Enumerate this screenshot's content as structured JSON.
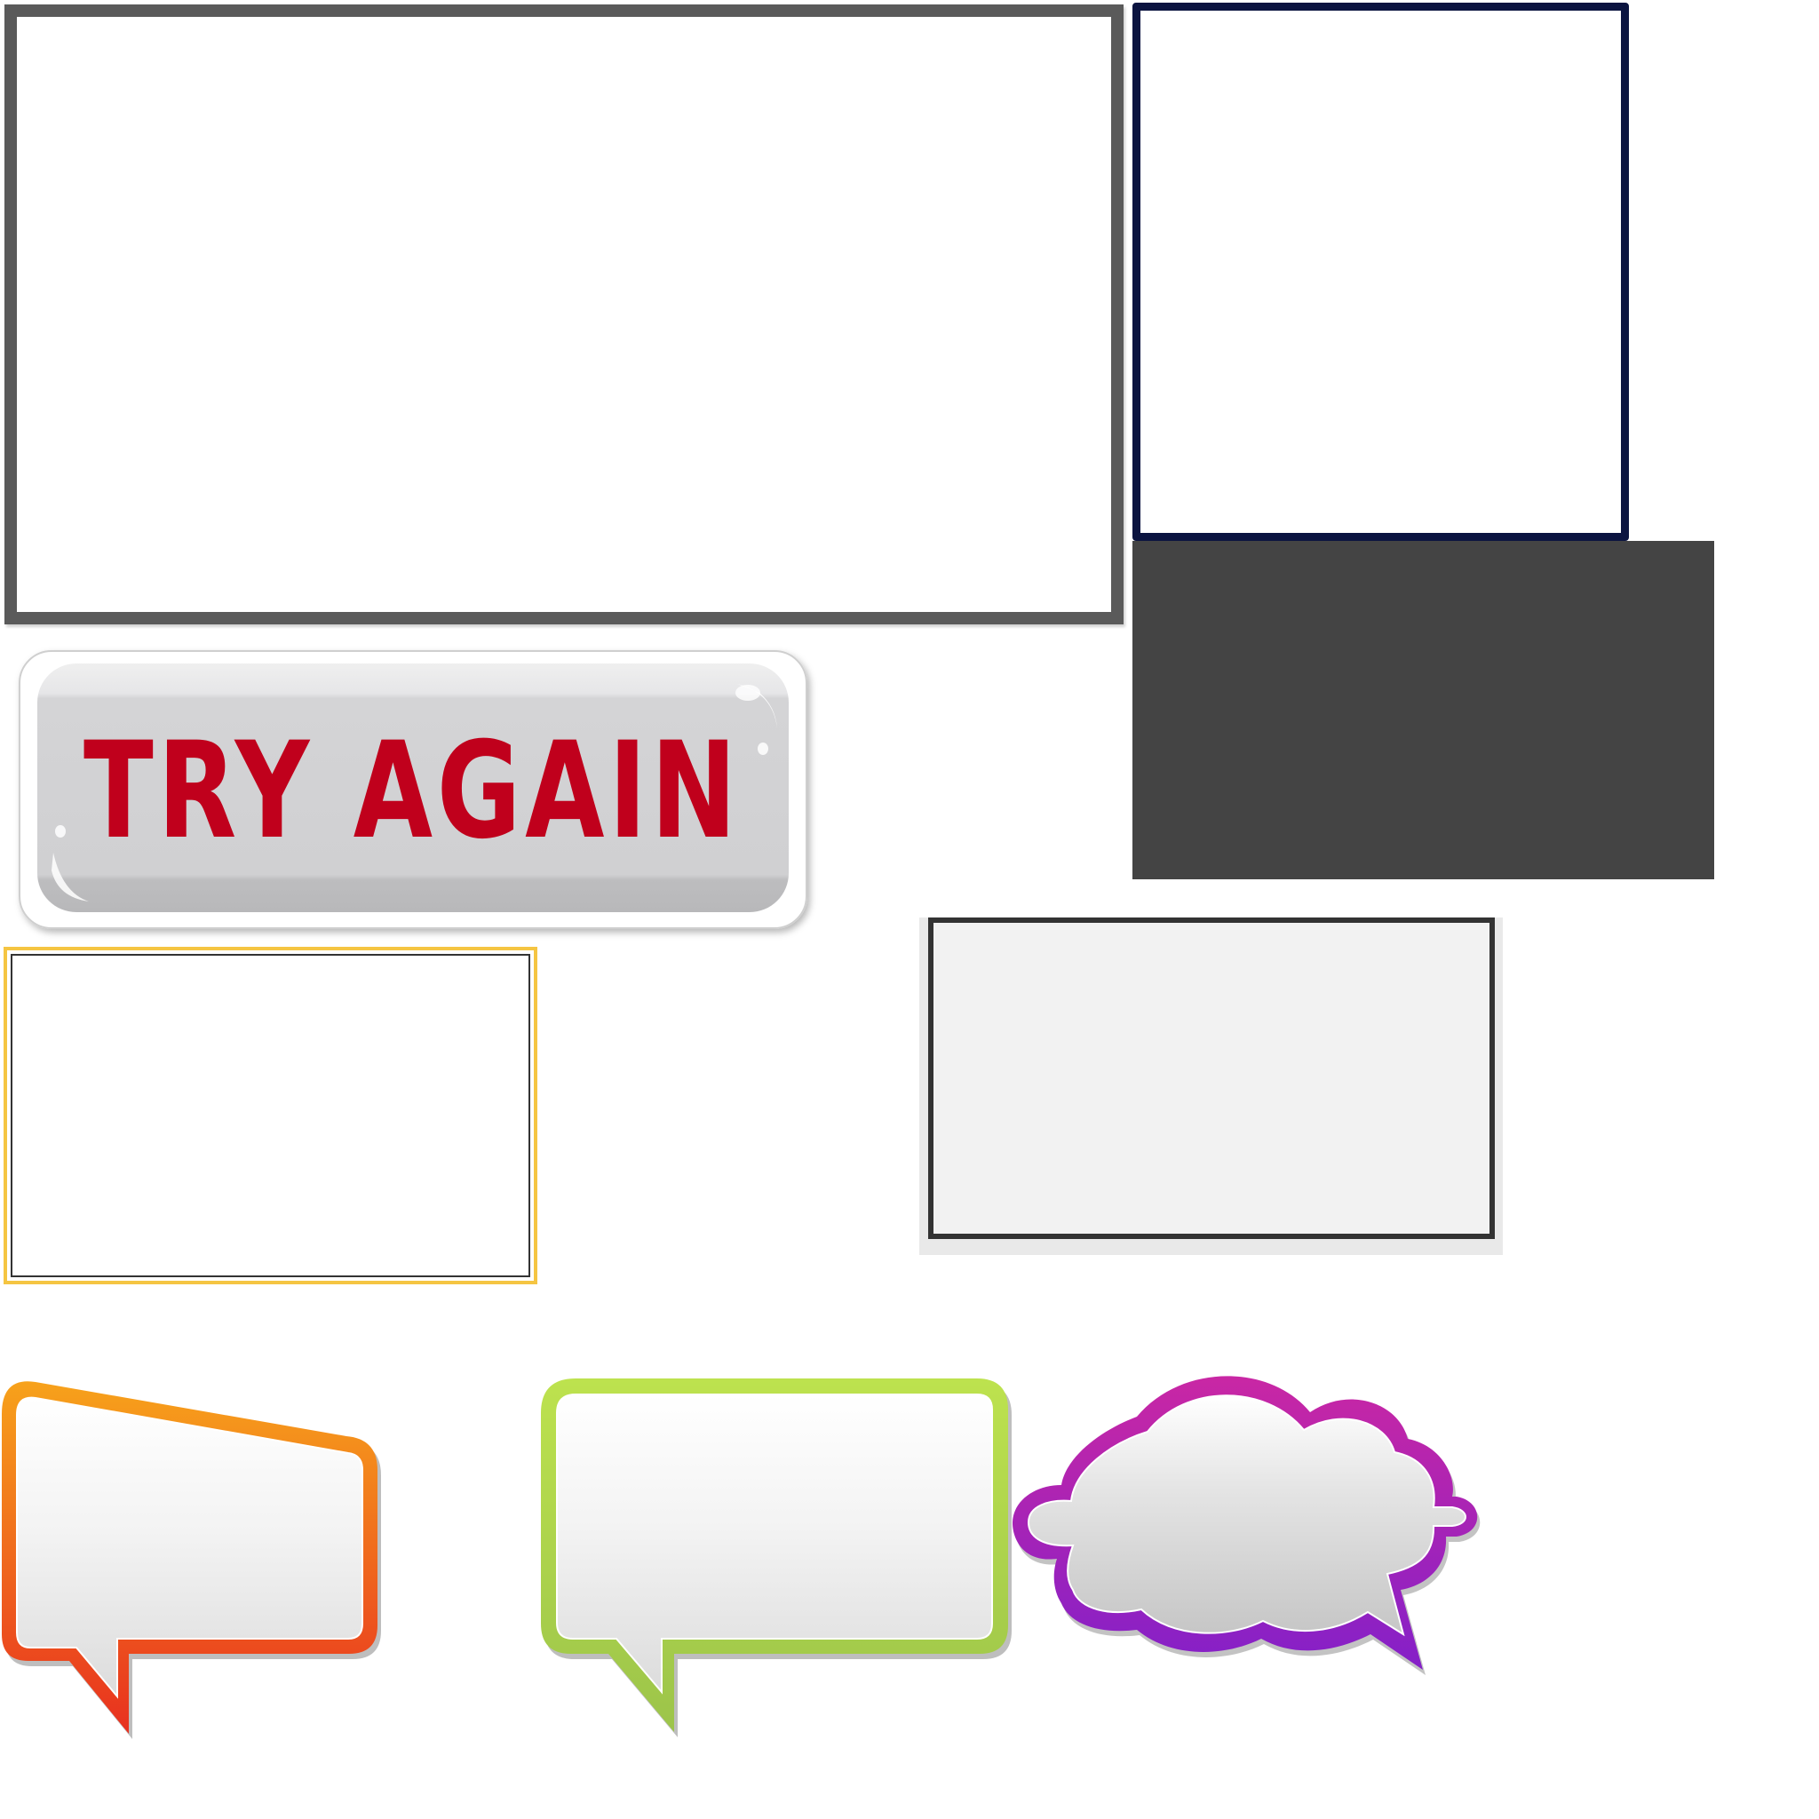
{
  "buttons": {
    "try_again_label": "TRY AGAIN"
  },
  "colors": {
    "frame_gray": "#5a5a5a",
    "frame_navy": "#0b1440",
    "panel_dark": "#444444",
    "frame_gold": "#f5c542",
    "panel_light": "#f2f2f2",
    "button_text": "#c0001a",
    "bubble_orange_top": "#f7a21b",
    "bubble_orange_bottom": "#e8301f",
    "bubble_green": "#b5dc4c",
    "bubble_purple_top": "#c125a5",
    "bubble_purple_bottom": "#8a1fc6"
  }
}
